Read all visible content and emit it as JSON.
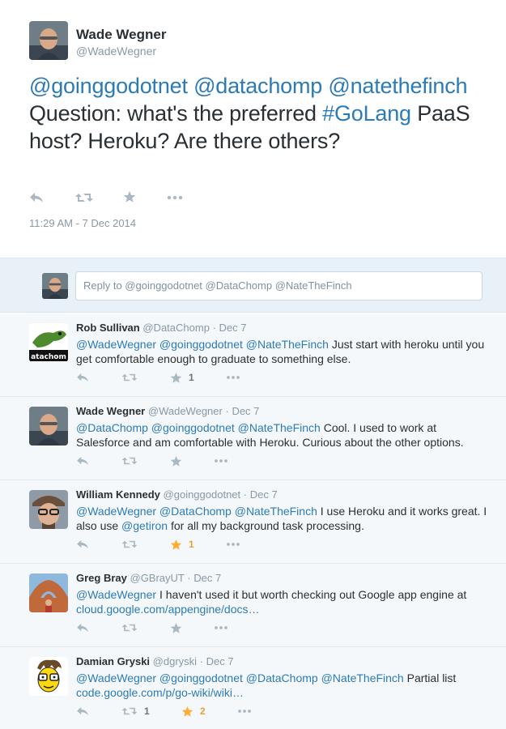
{
  "main_tweet": {
    "author_name": "Wade Wegner",
    "author_handle": "@WadeWegner",
    "mentions": [
      "@goinggodotnet",
      "@datachomp",
      "@natethefinch"
    ],
    "text_part1": "Question: what's the preferred",
    "hashtag": "#GoLang",
    "text_part2": "PaaS host? Heroku? Are there others?",
    "timestamp": "11:29 AM - 7 Dec 2014"
  },
  "reply_box": {
    "placeholder": "Reply to @goinggodotnet @DataChomp @NateTheFinch"
  },
  "replies": [
    {
      "name": "Rob Sullivan",
      "handle": "@DataChomp",
      "date": "Dec 7",
      "mentions": "@WadeWegner @goinggodotnet @NateTheFinch",
      "text": "Just start with heroku until you get comfortable enough to graduate to something else.",
      "retweets": "",
      "favorites": "1",
      "favorited": false
    },
    {
      "name": "Wade Wegner",
      "handle": "@WadeWegner",
      "date": "Dec 7",
      "mentions": "@DataChomp @goinggodotnet @NateTheFinch",
      "text": "Cool. I used to work at Salesforce and am comfortable with Heroku. Curious about the other options.",
      "retweets": "",
      "favorites": "",
      "favorited": false
    },
    {
      "name": "William Kennedy",
      "handle": "@goinggodotnet",
      "date": "Dec 7",
      "mentions": "@WadeWegner @DataChomp @NateTheFinch",
      "text_before": "I use Heroku and it works great. I also use",
      "inline_mention": "@getiron",
      "text_after": "for all my background task processing.",
      "retweets": "",
      "favorites": "1",
      "favorited": true
    },
    {
      "name": "Greg Bray",
      "handle": "@GBrayUT",
      "date": "Dec 7",
      "mentions": "@WadeWegner",
      "text": "I haven't used it but worth checking out Google app engine at",
      "link": "cloud.google.com/appengine/docs…",
      "retweets": "",
      "favorites": "",
      "favorited": false
    },
    {
      "name": "Damian Gryski",
      "handle": "@dgryski",
      "date": "Dec 7",
      "mentions": "@WadeWegner @goinggodotnet @DataChomp @NateTheFinch",
      "text": "Partial list",
      "link": "code.google.com/p/go-wiki/wiki…",
      "retweets": "1",
      "favorites": "2",
      "favorited": true
    }
  ],
  "colors": {
    "link": "#2b7bb9",
    "text": "#292f33",
    "muted": "#8899a6",
    "icon": "#aab8c2",
    "favorite": "#ffac33",
    "reply_bg": "#f5f8fa",
    "replybar_bg": "#e8f1f8"
  },
  "icons": [
    "reply-icon",
    "retweet-icon",
    "favorite-star-icon",
    "more-dots-icon"
  ]
}
